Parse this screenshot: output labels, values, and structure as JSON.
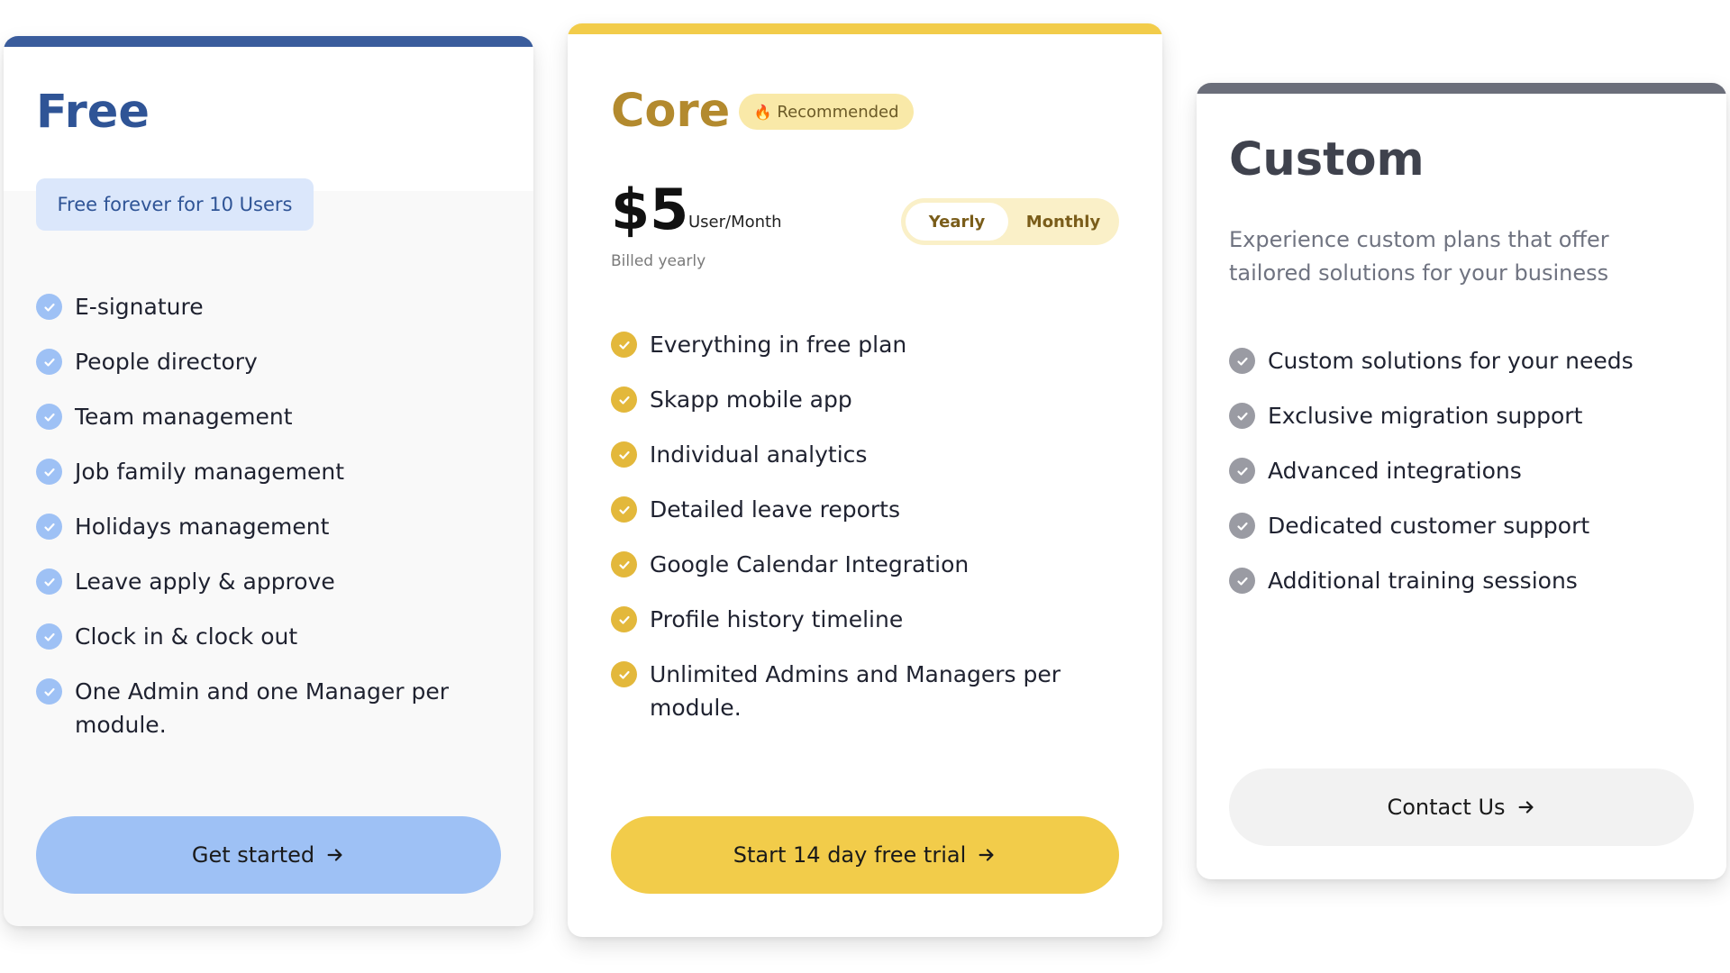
{
  "plans": {
    "free": {
      "title": "Free",
      "chip": "Free forever for 10 Users",
      "features": [
        "E-signature",
        "People directory",
        "Team management",
        "Job family management",
        "Holidays management",
        "Leave apply & approve",
        "Clock in & clock out",
        "One Admin and one Manager per module."
      ],
      "button": "Get started",
      "accent": "#3a5c9c"
    },
    "core": {
      "title": "Core",
      "badge": "Recommended",
      "price": "$5",
      "unit": "User/Month",
      "billed": "Billed yearly",
      "toggle": {
        "yearly": "Yearly",
        "monthly": "Monthly",
        "selected": "Yearly"
      },
      "features": [
        "Everything in free plan",
        "Skapp mobile app",
        "Individual analytics",
        "Detailed leave reports",
        "Google Calendar Integration",
        "Profile history timeline",
        "Unlimited Admins and Managers per module."
      ],
      "button": "Start 14 day free trial",
      "accent": "#f2cc4a"
    },
    "custom": {
      "title": "Custom",
      "description": "Experience custom plans that offer tailored solutions for your business",
      "features": [
        "Custom solutions for your needs",
        "Exclusive migration support",
        "Advanced integrations",
        "Dedicated customer support",
        "Additional training sessions"
      ],
      "button": "Contact Us",
      "accent": "#6b6e7a"
    }
  },
  "icons": {
    "check": "check-icon",
    "arrow": "arrow-right-icon",
    "flame": "flame-icon"
  }
}
